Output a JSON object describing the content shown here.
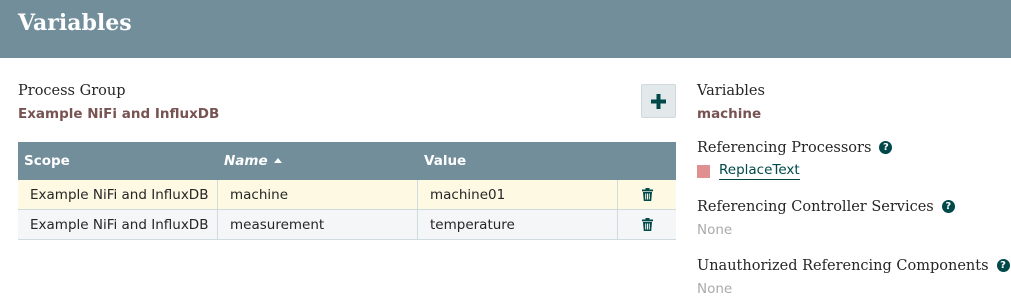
{
  "header": {
    "title": "Variables"
  },
  "process_group": {
    "label": "Process Group",
    "name": "Example NiFi and InfluxDB"
  },
  "add_button": {
    "icon": "plus-icon"
  },
  "table": {
    "columns": {
      "scope": "Scope",
      "name": "Name",
      "value": "Value"
    },
    "sort": {
      "column": "Name",
      "direction": "ascending"
    },
    "rows": [
      {
        "scope": "Example NiFi and InfluxDB",
        "name": "machine",
        "value": "machine01",
        "action_icon": "trash-icon",
        "selected": true
      },
      {
        "scope": "Example NiFi and InfluxDB",
        "name": "measurement",
        "value": "temperature",
        "action_icon": "trash-icon",
        "selected": false
      }
    ]
  },
  "details": {
    "variables_label": "Variables",
    "variable_name": "machine",
    "referencing_processors_label": "Referencing Processors",
    "processors": [
      {
        "name": "ReplaceText",
        "status_color": "#e09090"
      }
    ],
    "referencing_services_label": "Referencing Controller Services",
    "referencing_services_value": "None",
    "unauthorized_label": "Unauthorized Referencing Components",
    "unauthorized_value": "None"
  },
  "colors": {
    "header": "#728e9b",
    "accent_brown": "#775351",
    "link": "#004849"
  }
}
